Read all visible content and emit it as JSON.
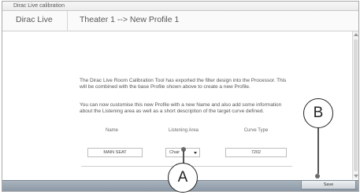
{
  "window": {
    "title": "Dirac Live calibration"
  },
  "header": {
    "app_name": "Dirac Live",
    "profile_path": "Theater 1 --> New Profile 1"
  },
  "body": {
    "paragraph1": "The Dirac Live Room Calibration Tool has exported the filter design into the Processor. This will be combined with the base Profile shown above to create a new Profile.",
    "paragraph2": "You can now customise this new Profile with a new Name and also add some information about the Listening area as well as a short description of the target curve defined."
  },
  "table": {
    "headers": {
      "name": "Name",
      "listening_area": "Listening Area",
      "curve_type": "Curve Type"
    },
    "row": {
      "name_value": "MAIN SEAT",
      "listening_area_value": "Chair",
      "curve_type_value": "7202"
    }
  },
  "footer": {
    "save_label": "Save"
  },
  "callouts": {
    "a_label": "A",
    "b_label": "B"
  },
  "colors": {
    "footer_bar": "#8996a3",
    "text": "#555555"
  },
  "icons": {
    "select_chevron": "chevron-down-icon",
    "scroll_up": "arrow-up-icon",
    "scroll_down": "arrow-down-icon"
  }
}
